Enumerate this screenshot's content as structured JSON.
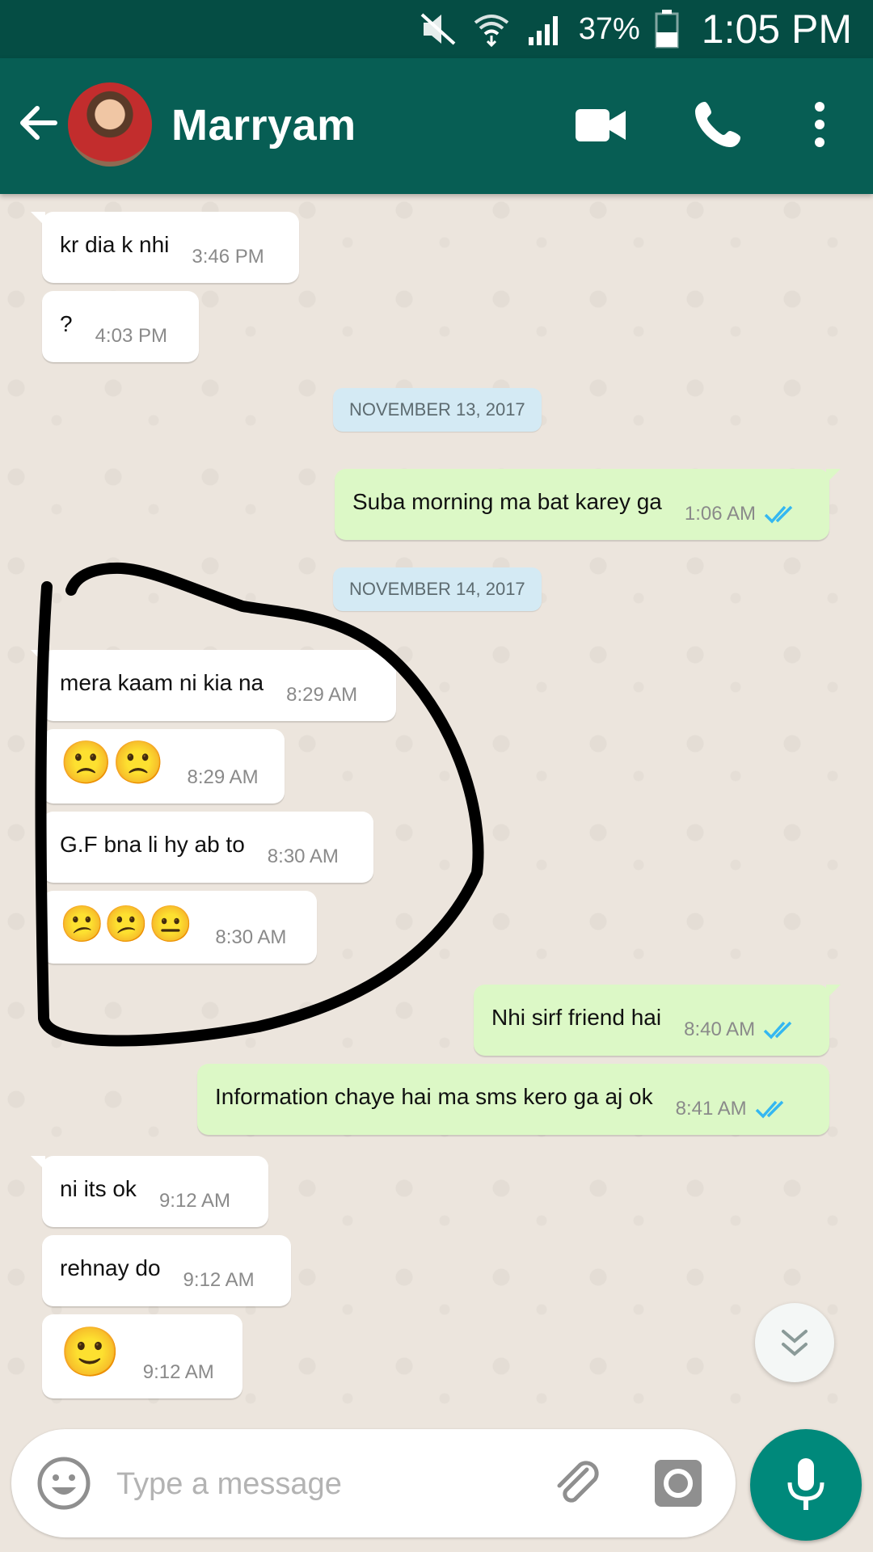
{
  "status_bar": {
    "battery": "37%",
    "time": "1:05 PM"
  },
  "header": {
    "contact_name": "Marryam"
  },
  "messages": [
    {
      "text": "kr dia k nhi",
      "time": "3:46 PM"
    },
    {
      "text": "?",
      "time": "4:03 PM"
    },
    {
      "date_chip": "NOVEMBER 13, 2017"
    },
    {
      "text": "Suba morning ma bat karey ga",
      "time": "1:06 AM"
    },
    {
      "date_chip": "NOVEMBER 14, 2017"
    },
    {
      "text": "mera kaam ni kia na",
      "time": "8:29 AM"
    },
    {
      "text": "🙁🙁",
      "time": "8:29 AM"
    },
    {
      "text": "G.F bna li hy ab to",
      "time": "8:30 AM"
    },
    {
      "text": "😕😕😐",
      "time": "8:30 AM"
    },
    {
      "text": "Nhi sirf friend hai",
      "time": "8:40 AM"
    },
    {
      "text": "Information chaye hai ma sms kero ga aj ok",
      "time": "8:41 AM"
    },
    {
      "text": "ni its ok",
      "time": "9:12 AM"
    },
    {
      "text": "rehnay do",
      "time": "9:12 AM"
    },
    {
      "text": "🙂",
      "time": "9:12 AM"
    }
  ],
  "input": {
    "placeholder": "Type a message"
  },
  "icons": {
    "back": "arrow-left-icon",
    "video": "video-camera-icon",
    "call": "phone-icon",
    "menu": "more-vert-icon",
    "scroll_down": "double-chevron-down-icon",
    "emoji": "smiley-icon",
    "attach": "paperclip-icon",
    "camera": "camera-icon",
    "mic": "microphone-icon",
    "read_receipt": "double-check-icon"
  },
  "colors": {
    "header": "#075e54",
    "status_bar": "#054d44",
    "outgoing_bubble": "#dcf8c6",
    "incoming_bubble": "#ffffff",
    "chat_bg": "#ece5dd",
    "date_chip": "#d4eaf4",
    "read_ticks": "#34b7f1",
    "mic_button": "#00897b"
  }
}
